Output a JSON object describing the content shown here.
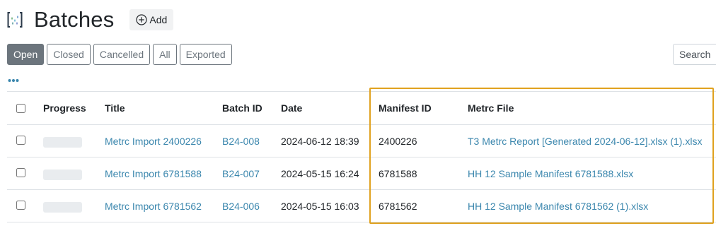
{
  "header": {
    "title": "Batches",
    "add_label": "Add",
    "logo_icon": "batches-logo-icon",
    "add_icon": "plus-circle-icon"
  },
  "filters": [
    {
      "label": "Open",
      "active": true
    },
    {
      "label": "Closed",
      "active": false
    },
    {
      "label": "Cancelled",
      "active": false
    },
    {
      "label": "All",
      "active": false
    },
    {
      "label": "Exported",
      "active": false
    }
  ],
  "search": {
    "placeholder": "Search"
  },
  "more_icon": "ellipsis-icon",
  "table": {
    "columns": [
      "Progress",
      "Title",
      "Batch ID",
      "Date",
      "Manifest ID",
      "Metrc File"
    ],
    "rows": [
      {
        "title": "Metrc Import 2400226",
        "batch_id": "B24-008",
        "date": "2024-06-12 18:39",
        "manifest_id": "2400226",
        "metrc_file": "T3 Metrc Report [Generated 2024-06-12].xlsx (1).xlsx"
      },
      {
        "title": "Metrc Import 6781588",
        "batch_id": "B24-007",
        "date": "2024-05-15 16:24",
        "manifest_id": "6781588",
        "metrc_file": "HH 12 Sample Manifest 6781588.xlsx"
      },
      {
        "title": "Metrc Import 6781562",
        "batch_id": "B24-006",
        "date": "2024-05-15 16:03",
        "manifest_id": "6781562",
        "metrc_file": "HH 12 Sample Manifest 6781562 (1).xlsx"
      }
    ]
  },
  "colors": {
    "link": "#3a86ad",
    "active_filter_bg": "#6c757d",
    "highlight_border": "#e0a21f",
    "progress_placeholder": "#e9ecef"
  }
}
